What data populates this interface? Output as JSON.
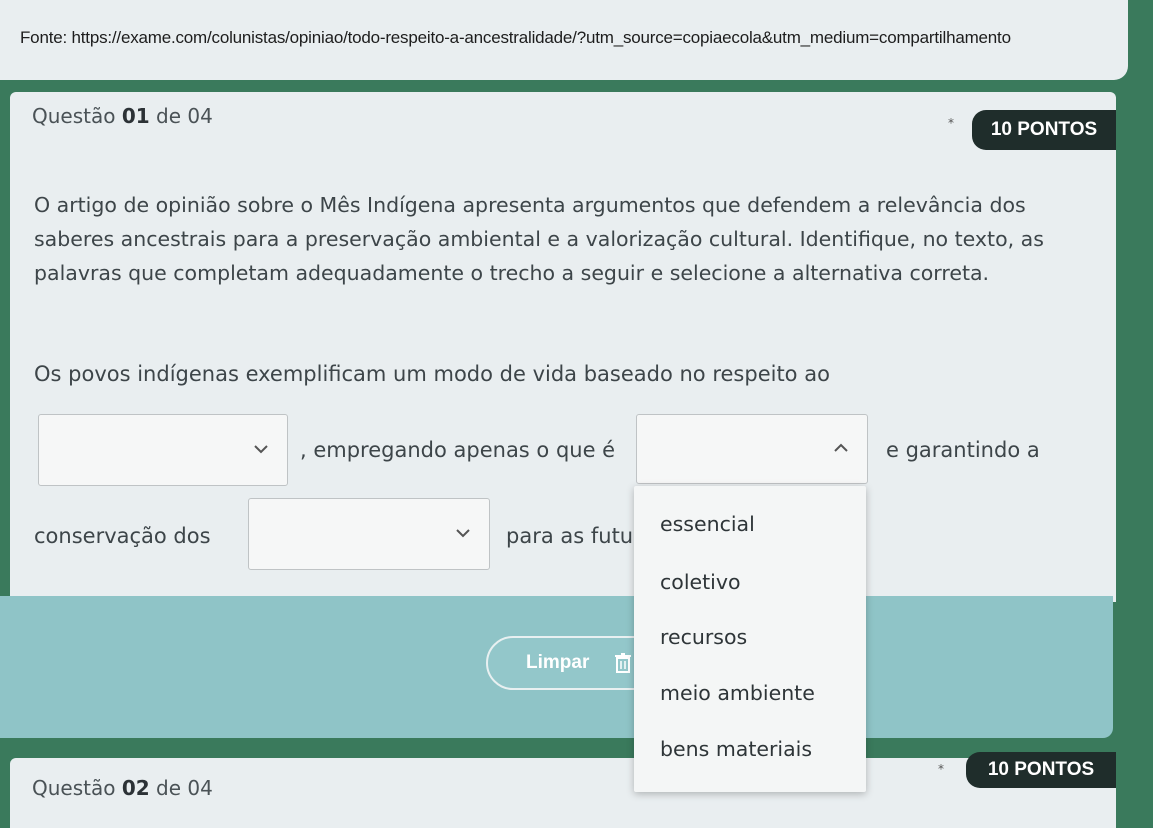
{
  "source": {
    "text": "Fonte: https://exame.com/colunistas/opiniao/todo-respeito-a-ancestralidade/?utm_source=copiaecola&utm_medium=compartilhamento"
  },
  "question1": {
    "label_prefix": "Questão",
    "number": "01",
    "label_suffix": "de 04",
    "points": "10 PONTOS",
    "prompt": "O artigo de opinião sobre o Mês Indígena apresenta argumentos que defendem a relevância dos saberes ancestrais para a preservação ambiental e a valorização cultural. Identifique, no texto, as palavras que completam adequadamente o trecho a seguir e selecione a alternativa correta.",
    "sentence_line1": "Os povos indígenas exemplificam um modo de vida baseado no respeito ao",
    "between_1_2": ", empregando apenas o que é",
    "after_2": "e garantindo a",
    "before_3": "conservação dos",
    "after_3": "para as futu",
    "select1_value": "",
    "select2_value": "",
    "select3_value": ""
  },
  "dropdown": {
    "options": [
      "essencial",
      "coletivo",
      "recursos",
      "meio ambiente",
      "bens materiais"
    ]
  },
  "actions": {
    "clear_label": "Limpar"
  },
  "question2": {
    "label_prefix": "Questão",
    "number": "02",
    "label_suffix": "de 04",
    "points": "10 PONTOS"
  },
  "icons": {
    "select_closed": "chevron-down-icon",
    "select_open": "chevron-up-icon",
    "clear": "trash-icon",
    "required": "asterisk-icon"
  },
  "colors": {
    "background": "#3a7a5c",
    "card": "#e9eef0",
    "badge": "#1f2d2b",
    "actions_band": "#8fc4c7"
  }
}
